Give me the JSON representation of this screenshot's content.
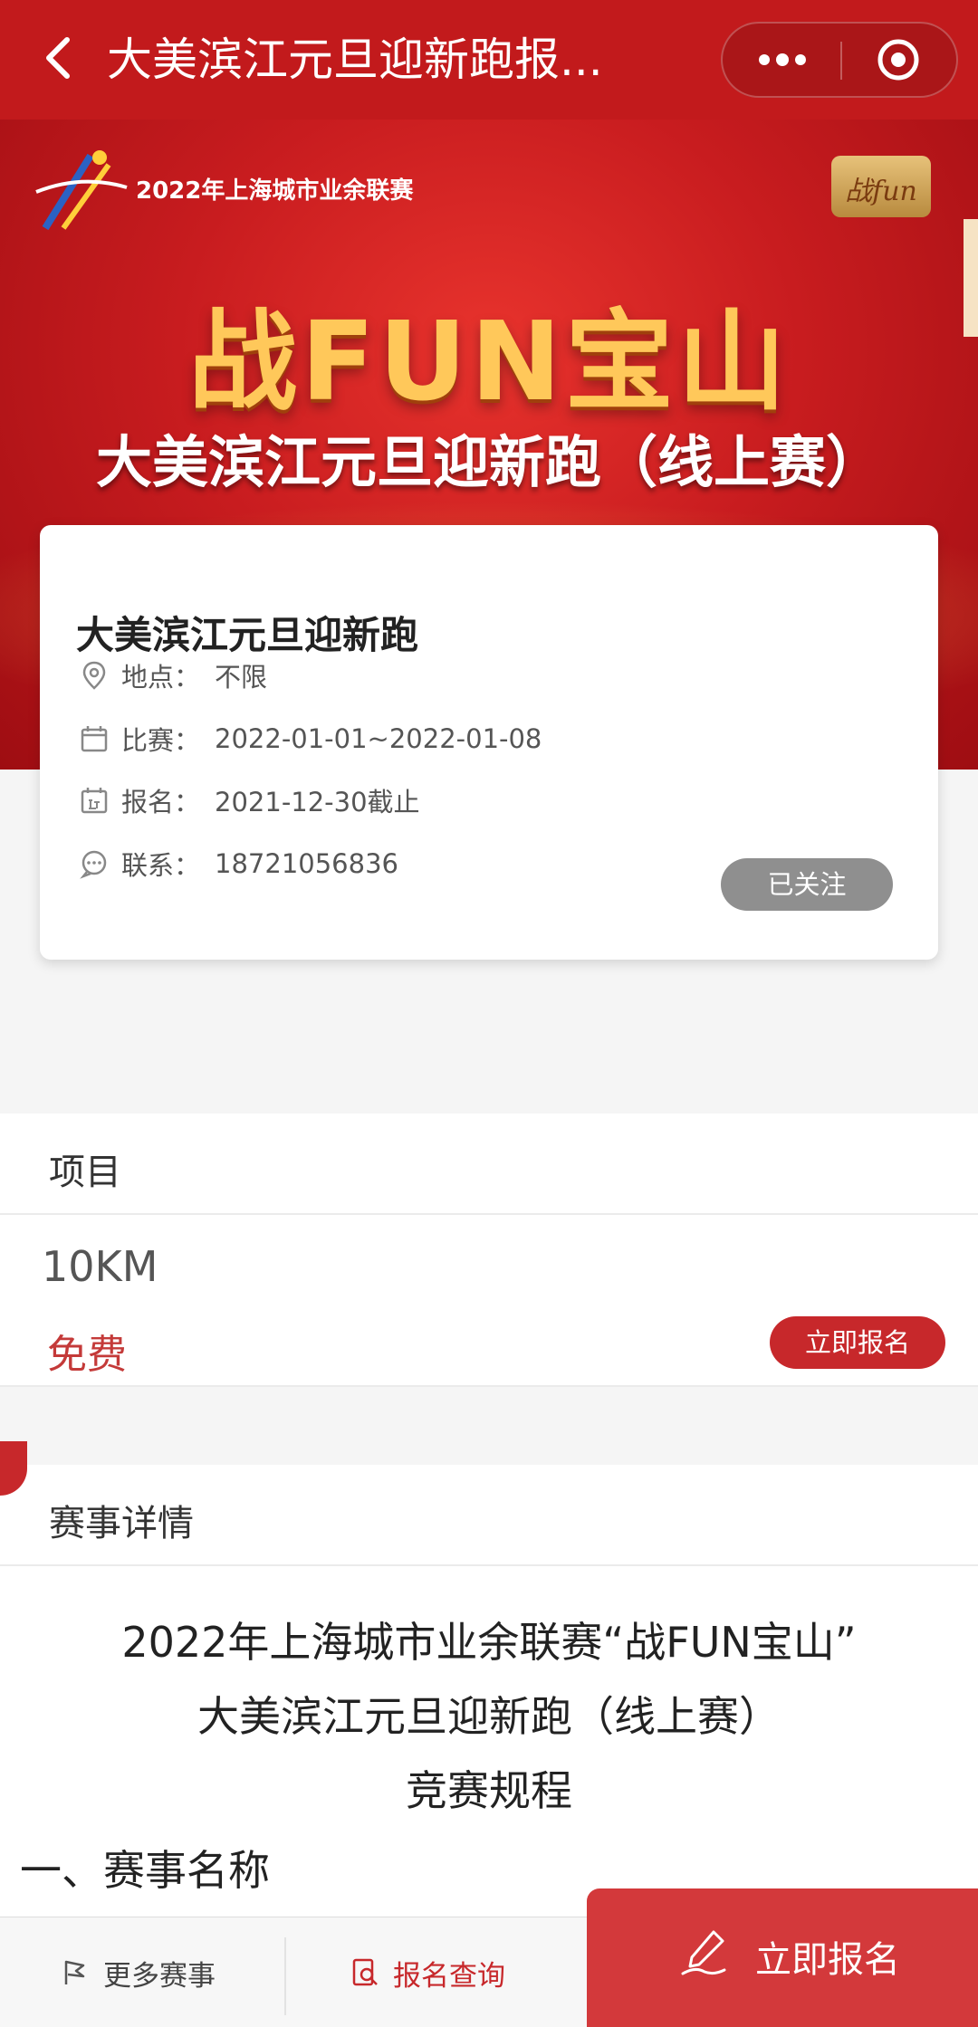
{
  "navbar": {
    "title": "大美滨江元旦迎新跑报...",
    "more_icon": "ellipsis-icon",
    "close_icon": "target-circle-icon"
  },
  "banner": {
    "league": "2022年上海城市业余联赛",
    "badge": "战fun",
    "main_title": "战FUN宝山",
    "subtitle": "大美滨江元旦迎新跑（线上赛）"
  },
  "event": {
    "title": "大美滨江元旦迎新跑",
    "location_label": "地点：",
    "location_value": "不限",
    "race_label": "比赛：",
    "race_value": "2022-01-01~2022-01-08",
    "signup_label": "报名：",
    "signup_value": "2021-12-30截止",
    "contact_label": "联系：",
    "contact_value": "18721056836",
    "follow_button": "已关注"
  },
  "projects": {
    "header": "项目",
    "items": [
      {
        "name": "10KM",
        "price": "免费",
        "button": "立即报名"
      }
    ]
  },
  "details": {
    "header": "赛事详情",
    "lines": [
      "2022年上海城市业余联赛“战FUN宝山”",
      "大美滨江元旦迎新跑（线上赛）",
      "竞赛规程"
    ],
    "section_1": "一、赛事名称"
  },
  "bottom_bar": {
    "more_events": "更多赛事",
    "signup_query": "报名查询",
    "signup_now": "立即报名"
  },
  "colors": {
    "brand_red": "#c21a1c",
    "button_red": "#c7282b",
    "price_red": "#c43a39",
    "follow_gray": "#8f8f8f"
  }
}
